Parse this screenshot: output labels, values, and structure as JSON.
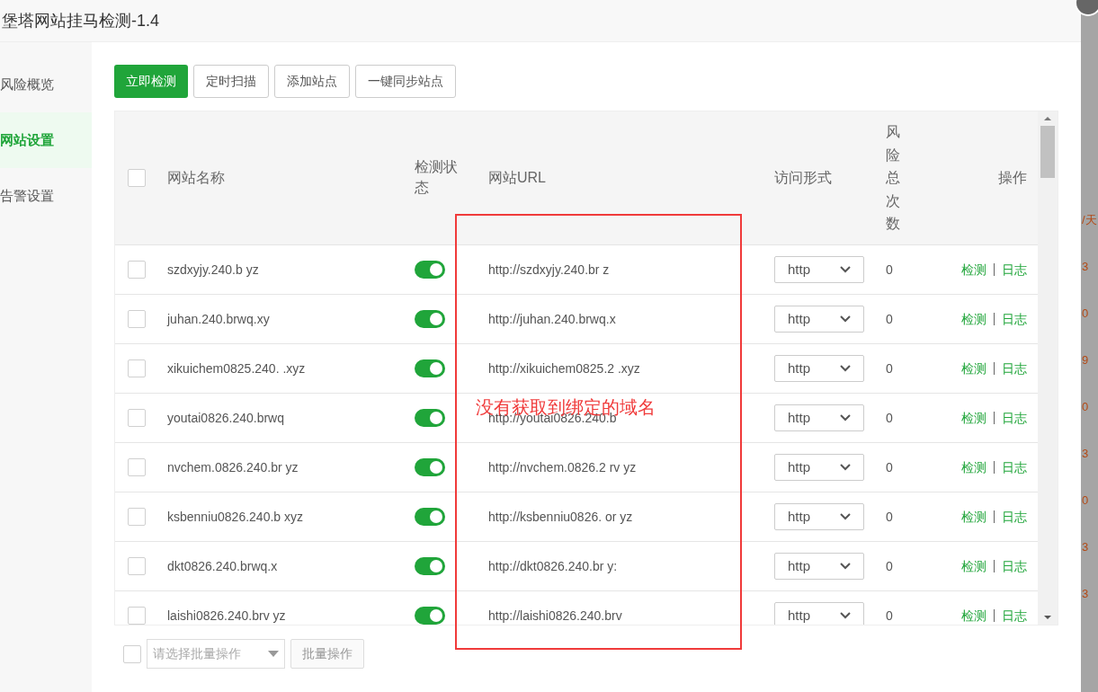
{
  "window": {
    "title": "堡塔网站挂马检测-1.4"
  },
  "sidebar": {
    "items": [
      {
        "label": "风险概览",
        "selected": false
      },
      {
        "label": "网站设置",
        "selected": true
      },
      {
        "label": "告警设置",
        "selected": false
      }
    ]
  },
  "toolbar": [
    {
      "label": "立即检测",
      "kind": "primary"
    },
    {
      "label": "定时扫描",
      "kind": "default"
    },
    {
      "label": "添加站点",
      "kind": "default"
    },
    {
      "label": "一键同步站点",
      "kind": "default"
    }
  ],
  "table": {
    "select_all": {
      "checked": false
    },
    "columns": [
      "网站名称",
      "检测状态",
      "网站URL",
      "访问形式",
      "风险总次数",
      "操作"
    ],
    "rows": [
      {
        "checked": false,
        "name": "szdxyjy.240.b yz",
        "on": true,
        "url": "http://szdxyjy.240.br z",
        "access": "http",
        "risk": "0",
        "actions": [
          "检测",
          "日志"
        ]
      },
      {
        "checked": false,
        "name": "juhan.240.brwq.xy",
        "on": true,
        "url": "http://juhan.240.brwq.x",
        "access": "http",
        "risk": "0",
        "actions": [
          "检测",
          "日志"
        ]
      },
      {
        "checked": false,
        "name": "xikuichem0825.240. .xyz",
        "on": true,
        "url": "http://xikuichem0825.2 .xyz",
        "access": "http",
        "risk": "0",
        "actions": [
          "检测",
          "日志"
        ]
      },
      {
        "checked": false,
        "name": "youtai0826.240.brwq",
        "on": true,
        "url": "http://youtai0826.240.b",
        "access": "http",
        "risk": "0",
        "actions": [
          "检测",
          "日志"
        ]
      },
      {
        "checked": false,
        "name": "nvchem.0826.240.br yz",
        "on": true,
        "url": "http://nvchem.0826.2 rv yz",
        "access": "http",
        "risk": "0",
        "actions": [
          "检测",
          "日志"
        ]
      },
      {
        "checked": false,
        "name": "ksbenniu0826.240.b xyz",
        "on": true,
        "url": "http://ksbenniu0826. or yz",
        "access": "http",
        "risk": "0",
        "actions": [
          "检测",
          "日志"
        ]
      },
      {
        "checked": false,
        "name": "dkt0826.240.brwq.x",
        "on": true,
        "url": "http://dkt0826.240.br y:",
        "access": "http",
        "risk": "0",
        "actions": [
          "检测",
          "日志"
        ]
      },
      {
        "checked": false,
        "name": "laishi0826.240.brv yz",
        "on": true,
        "url": "http://laishi0826.240.brv",
        "access": "http",
        "risk": "0",
        "actions": [
          "检测",
          "日志"
        ]
      }
    ]
  },
  "batch": {
    "checked": false,
    "placeholder": "请选择批量操作",
    "button": "批量操作"
  },
  "annotation": {
    "text": "没有获取到绑定的域名"
  },
  "background": {
    "fragments": [
      "/天",
      "3",
      "0",
      "9",
      "0",
      "3",
      "0",
      "3",
      "3"
    ]
  }
}
